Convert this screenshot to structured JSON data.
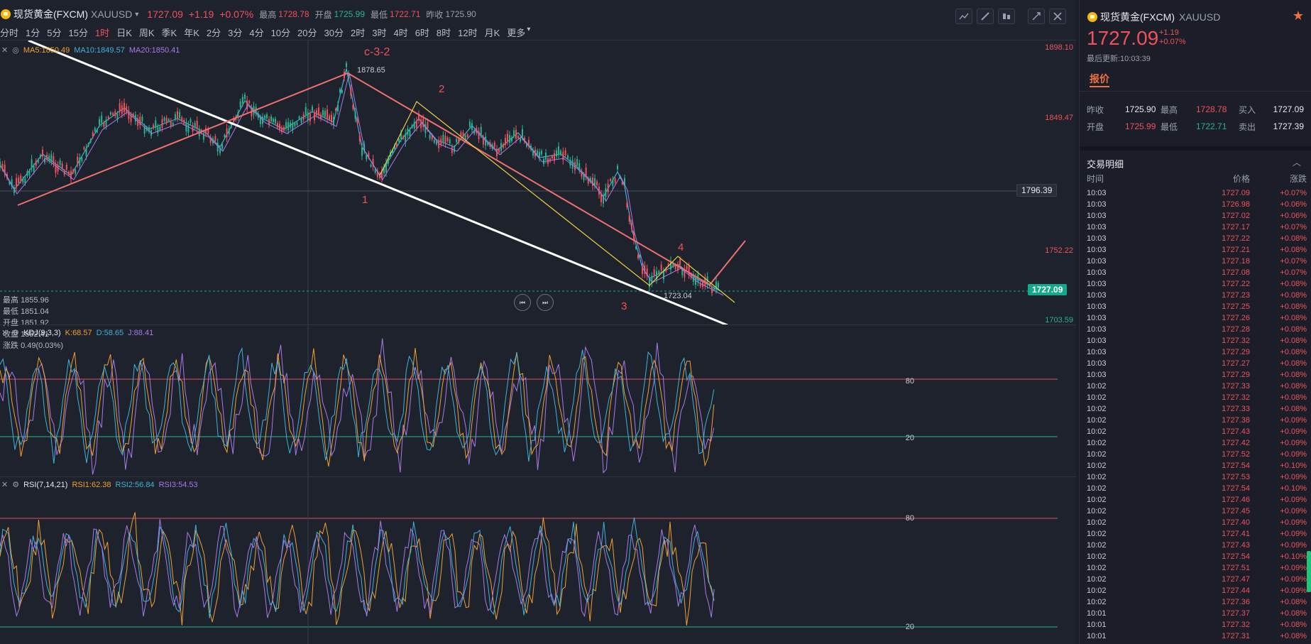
{
  "header": {
    "symbol_name": "现货黄金(FXCM)",
    "symbol_code": "XAUUSD",
    "price": "1727.09",
    "change": "+1.19",
    "change_pct": "+0.07%",
    "high_label": "最高",
    "high": "1728.78",
    "open_label": "开盘",
    "open": "1725.99",
    "low_label": "最低",
    "low": "1722.71",
    "prev_close_label": "昨收",
    "prev_close": "1725.90"
  },
  "toolbar_icons": [
    "indicator-icon",
    "draw-icon",
    "toggle-icon",
    "expand-icon",
    "close-icon"
  ],
  "intervals": [
    "分时",
    "1分",
    "5分",
    "15分",
    "1时",
    "日K",
    "周K",
    "季K",
    "年K",
    "2分",
    "3分",
    "4分",
    "10分",
    "20分",
    "30分",
    "2时",
    "3时",
    "4时",
    "6时",
    "8时",
    "12时",
    "月K",
    "更多"
  ],
  "active_interval": 4,
  "main_chart": {
    "ma_labels": [
      "MA5:1850.49",
      "MA10:1849.57",
      "MA20:1850.41"
    ],
    "axis": [
      "1898.10",
      "1849.47",
      "1752.22",
      "1703.59"
    ],
    "bell_price": "1796.39",
    "current_price": "1727.09",
    "peak_label": "1878.65",
    "low_label": "1723.04",
    "wave_labels": [
      "c-3-2",
      "1",
      "2",
      "3",
      "4"
    ],
    "info": {
      "high_label": "最高",
      "high": "1855.96",
      "low_label": "最低",
      "low": "1851.04",
      "open_label": "开盘",
      "open": "1851.92",
      "close_label": "收盘",
      "close": "1852.41",
      "chg_label": "涨跌",
      "chg": "0.49(0.03%)"
    }
  },
  "kdj": {
    "name": "KDJ(9,3,3)",
    "k": "K:68.57",
    "d": "D:58.65",
    "j": "J:88.41",
    "levels": [
      "80",
      "20"
    ]
  },
  "rsi": {
    "name": "RSI(7,14,21)",
    "r1": "RSI1:62.38",
    "r2": "RSI2:56.84",
    "r3": "RSI3:54.53",
    "levels": [
      "80",
      "20"
    ]
  },
  "side": {
    "name": "现货黄金(FXCM)",
    "code": "XAUUSD",
    "price": "1727.09",
    "change": "+1.19",
    "change_pct": "+0.07%",
    "updated": "最后更新:10:03:39",
    "tab": "报价",
    "quote": {
      "prev_close_label": "昨收",
      "prev_close": "1725.90",
      "high_label": "最高",
      "high": "1728.78",
      "bid_label": "买入",
      "bid": "1727.09",
      "open_label": "开盘",
      "open": "1725.99",
      "low_label": "最低",
      "low": "1722.71",
      "ask_label": "卖出",
      "ask": "1727.39"
    },
    "trades_title": "交易明细",
    "col_time": "时间",
    "col_price": "价格",
    "col_change": "涨跌",
    "trades": [
      [
        "10:03",
        "1727.09",
        "+0.07%"
      ],
      [
        "10:03",
        "1726.98",
        "+0.06%"
      ],
      [
        "10:03",
        "1727.02",
        "+0.06%"
      ],
      [
        "10:03",
        "1727.17",
        "+0.07%"
      ],
      [
        "10:03",
        "1727.22",
        "+0.08%"
      ],
      [
        "10:03",
        "1727.21",
        "+0.08%"
      ],
      [
        "10:03",
        "1727.18",
        "+0.07%"
      ],
      [
        "10:03",
        "1727.08",
        "+0.07%"
      ],
      [
        "10:03",
        "1727.22",
        "+0.08%"
      ],
      [
        "10:03",
        "1727.23",
        "+0.08%"
      ],
      [
        "10:03",
        "1727.25",
        "+0.08%"
      ],
      [
        "10:03",
        "1727.26",
        "+0.08%"
      ],
      [
        "10:03",
        "1727.28",
        "+0.08%"
      ],
      [
        "10:03",
        "1727.32",
        "+0.08%"
      ],
      [
        "10:03",
        "1727.29",
        "+0.08%"
      ],
      [
        "10:03",
        "1727.27",
        "+0.08%"
      ],
      [
        "10:03",
        "1727.29",
        "+0.08%"
      ],
      [
        "10:02",
        "1727.33",
        "+0.08%"
      ],
      [
        "10:02",
        "1727.32",
        "+0.08%"
      ],
      [
        "10:02",
        "1727.33",
        "+0.08%"
      ],
      [
        "10:02",
        "1727.38",
        "+0.09%"
      ],
      [
        "10:02",
        "1727.43",
        "+0.09%"
      ],
      [
        "10:02",
        "1727.42",
        "+0.09%"
      ],
      [
        "10:02",
        "1727.52",
        "+0.09%"
      ],
      [
        "10:02",
        "1727.54",
        "+0.10%"
      ],
      [
        "10:02",
        "1727.53",
        "+0.09%"
      ],
      [
        "10:02",
        "1727.54",
        "+0.10%"
      ],
      [
        "10:02",
        "1727.46",
        "+0.09%"
      ],
      [
        "10:02",
        "1727.45",
        "+0.09%"
      ],
      [
        "10:02",
        "1727.40",
        "+0.09%"
      ],
      [
        "10:02",
        "1727.41",
        "+0.09%"
      ],
      [
        "10:02",
        "1727.43",
        "+0.09%"
      ],
      [
        "10:02",
        "1727.54",
        "+0.10%"
      ],
      [
        "10:02",
        "1727.51",
        "+0.09%"
      ],
      [
        "10:02",
        "1727.47",
        "+0.09%"
      ],
      [
        "10:02",
        "1727.44",
        "+0.09%"
      ],
      [
        "10:02",
        "1727.36",
        "+0.08%"
      ],
      [
        "10:01",
        "1727.37",
        "+0.08%"
      ],
      [
        "10:01",
        "1727.32",
        "+0.08%"
      ],
      [
        "10:01",
        "1727.31",
        "+0.08%"
      ]
    ]
  }
}
